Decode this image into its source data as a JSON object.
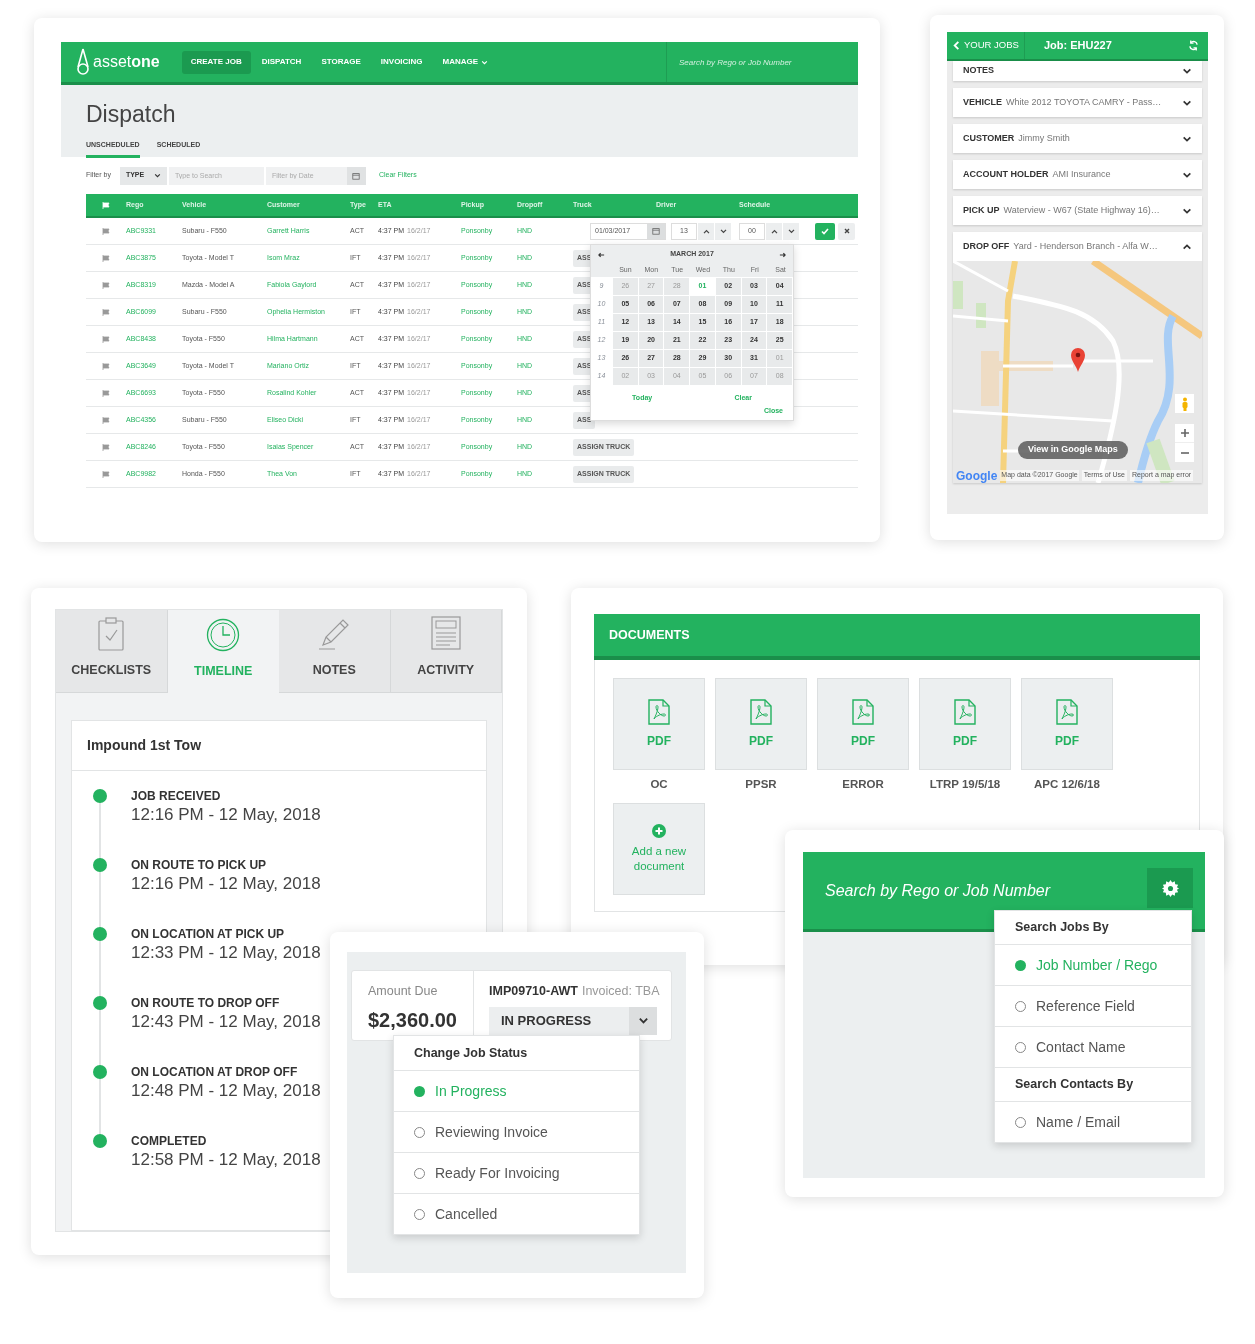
{
  "dispatch": {
    "nav": {
      "logo": "asset**one**",
      "items": [
        {
          "label": "CREATE JOB",
          "selected": true,
          "dropdown": false
        },
        {
          "label": "DISPATCH",
          "selected": false,
          "dropdown": false
        },
        {
          "label": "STORAGE",
          "selected": false,
          "dropdown": false
        },
        {
          "label": "INVOICING",
          "selected": false,
          "dropdown": false
        },
        {
          "label": "MANAGE",
          "selected": false,
          "dropdown": true
        }
      ],
      "search_placeholder": "Search by Rego or Job Number"
    },
    "title": "Dispatch",
    "tabs": [
      {
        "label": "UNSCHEDULED",
        "selected": true
      },
      {
        "label": "SCHEDULED",
        "selected": false
      }
    ],
    "filter": {
      "label": "Filter by",
      "type_value": "TYPE",
      "search_placeholder": "Type to Search",
      "date_placeholder": "Filter by Date",
      "clear": "Clear Filters"
    },
    "table": {
      "columns": [
        "Rego",
        "Vehicle",
        "Customer",
        "Type",
        "ETA",
        "Pickup",
        "Dropoff",
        "Truck",
        "Driver",
        "Schedule"
      ],
      "rows": [
        {
          "rego": "ABC9331",
          "vehicle": "Subaru - F550",
          "customer": "Garrett Harris",
          "type": "ACT",
          "eta_time": "4:37 PM",
          "eta_date": "16/2/17",
          "pickup": "Ponsonby",
          "dropoff": "HND",
          "editor": {
            "date": "01/03/2017",
            "hour": "13",
            "minute": "00"
          }
        },
        {
          "rego": "ABC3875",
          "vehicle": "Toyota - Model T",
          "customer": "Isom Mraz",
          "type": "IFT",
          "eta_time": "4:37 PM",
          "eta_date": "16/2/17",
          "pickup": "Ponsonby",
          "dropoff": "HND",
          "truck": "ASS"
        },
        {
          "rego": "ABC8319",
          "vehicle": "Mazda - Model A",
          "customer": "Fabiola Gaylord",
          "type": "ACT",
          "eta_time": "4:37 PM",
          "eta_date": "16/2/17",
          "pickup": "Ponsonby",
          "dropoff": "HND",
          "truck": "ASS"
        },
        {
          "rego": "ABC6099",
          "vehicle": "Subaru - F550",
          "customer": "Ophelia Hermiston",
          "type": "IFT",
          "eta_time": "4:37 PM",
          "eta_date": "16/2/17",
          "pickup": "Ponsonby",
          "dropoff": "HND",
          "truck": "ASS"
        },
        {
          "rego": "ABC8438",
          "vehicle": "Toyota - F550",
          "customer": "Hilma Hartmann",
          "type": "ACT",
          "eta_time": "4:37 PM",
          "eta_date": "16/2/17",
          "pickup": "Ponsonby",
          "dropoff": "HND",
          "truck": "ASS"
        },
        {
          "rego": "ABC3649",
          "vehicle": "Toyota - Model T",
          "customer": "Mariano Ortiz",
          "type": "IFT",
          "eta_time": "4:37 PM",
          "eta_date": "16/2/17",
          "pickup": "Ponsonby",
          "dropoff": "HND",
          "truck": "ASS"
        },
        {
          "rego": "ABC6693",
          "vehicle": "Toyota - F550",
          "customer": "Rosalind Kohler",
          "type": "ACT",
          "eta_time": "4:37 PM",
          "eta_date": "16/2/17",
          "pickup": "Ponsonby",
          "dropoff": "HND",
          "truck": "ASS"
        },
        {
          "rego": "ABC4356",
          "vehicle": "Subaru - F550",
          "customer": "Eliseo Dicki",
          "type": "IFT",
          "eta_time": "4:37 PM",
          "eta_date": "16/2/17",
          "pickup": "Ponsonby",
          "dropoff": "HND",
          "truck": "ASS"
        },
        {
          "rego": "ABC8246",
          "vehicle": "Toyota - F550",
          "customer": "Isaias Spencer",
          "type": "ACT",
          "eta_time": "4:37 PM",
          "eta_date": "16/2/17",
          "pickup": "Ponsonby",
          "dropoff": "HND",
          "truck": "ASSIGN TRUCK"
        },
        {
          "rego": "ABC9982",
          "vehicle": "Honda - F550",
          "customer": "Thea Von",
          "type": "IFT",
          "eta_time": "4:37 PM",
          "eta_date": "16/2/17",
          "pickup": "Ponsonby",
          "dropoff": "HND",
          "truck": "ASSIGN TRUCK"
        }
      ]
    },
    "calendar": {
      "month": "MARCH 2017",
      "weekdays": [
        "Sun",
        "Mon",
        "Tue",
        "Wed",
        "Thu",
        "Fri",
        "Sat"
      ],
      "weeks": [
        {
          "number": "9",
          "days": [
            {
              "d": "26",
              "kind": "other",
              "selected": false
            },
            {
              "d": "27",
              "kind": "other",
              "selected": false
            },
            {
              "d": "28",
              "kind": "other",
              "selected": false
            },
            {
              "d": "01",
              "kind": "current",
              "selected": true
            },
            {
              "d": "02",
              "kind": "current",
              "selected": false
            },
            {
              "d": "03",
              "kind": "current",
              "selected": false
            },
            {
              "d": "04",
              "kind": "current",
              "selected": false
            }
          ]
        },
        {
          "number": "10",
          "days": [
            {
              "d": "05",
              "kind": "current",
              "selected": false
            },
            {
              "d": "06",
              "kind": "current",
              "selected": false
            },
            {
              "d": "07",
              "kind": "current",
              "selected": false
            },
            {
              "d": "08",
              "kind": "current",
              "selected": false
            },
            {
              "d": "09",
              "kind": "current",
              "selected": false
            },
            {
              "d": "10",
              "kind": "current",
              "selected": false
            },
            {
              "d": "11",
              "kind": "current",
              "selected": false
            }
          ]
        },
        {
          "number": "11",
          "days": [
            {
              "d": "12",
              "kind": "current",
              "selected": false
            },
            {
              "d": "13",
              "kind": "current",
              "selected": false
            },
            {
              "d": "14",
              "kind": "current",
              "selected": false
            },
            {
              "d": "15",
              "kind": "current",
              "selected": false
            },
            {
              "d": "16",
              "kind": "current",
              "selected": false
            },
            {
              "d": "17",
              "kind": "current",
              "selected": false
            },
            {
              "d": "18",
              "kind": "current",
              "selected": false
            }
          ]
        },
        {
          "number": "12",
          "days": [
            {
              "d": "19",
              "kind": "current",
              "selected": false
            },
            {
              "d": "20",
              "kind": "current",
              "selected": false
            },
            {
              "d": "21",
              "kind": "current",
              "selected": false
            },
            {
              "d": "22",
              "kind": "current",
              "selected": false
            },
            {
              "d": "23",
              "kind": "current",
              "selected": false
            },
            {
              "d": "24",
              "kind": "current",
              "selected": false
            },
            {
              "d": "25",
              "kind": "current",
              "selected": false
            }
          ]
        },
        {
          "number": "13",
          "days": [
            {
              "d": "26",
              "kind": "current",
              "selected": false
            },
            {
              "d": "27",
              "kind": "current",
              "selected": false
            },
            {
              "d": "28",
              "kind": "current",
              "selected": false
            },
            {
              "d": "29",
              "kind": "current",
              "selected": false
            },
            {
              "d": "30",
              "kind": "current",
              "selected": false
            },
            {
              "d": "31",
              "kind": "current",
              "selected": false
            },
            {
              "d": "01",
              "kind": "other",
              "selected": false
            }
          ]
        },
        {
          "number": "14",
          "days": [
            {
              "d": "02",
              "kind": "other",
              "selected": false
            },
            {
              "d": "03",
              "kind": "other",
              "selected": false
            },
            {
              "d": "04",
              "kind": "other",
              "selected": false
            },
            {
              "d": "05",
              "kind": "other",
              "selected": false
            },
            {
              "d": "06",
              "kind": "other",
              "selected": false
            },
            {
              "d": "07",
              "kind": "other",
              "selected": false
            },
            {
              "d": "08",
              "kind": "other",
              "selected": false
            }
          ]
        }
      ],
      "today": "Today",
      "clear": "Clear",
      "close": "Close"
    }
  },
  "mobile": {
    "back": "YOUR JOBS",
    "title": "Job: EHU227",
    "items": [
      {
        "label": "NOTES",
        "value": "",
        "expanded": false
      },
      {
        "label": "VEHICLE",
        "value": "White 2012 TOYOTA CAMRY - Pass…",
        "expanded": false
      },
      {
        "label": "CUSTOMER",
        "value": "Jimmy Smith",
        "expanded": false
      },
      {
        "label": "ACCOUNT HOLDER",
        "value": "AMI Insurance",
        "expanded": false
      },
      {
        "label": "PICK UP",
        "value": "Waterview - W67 (State Highway 16)…",
        "expanded": false
      },
      {
        "label": "DROP OFF",
        "value": "Yard - Henderson Branch - Alfa W…",
        "expanded": true,
        "map": {
          "button": "View in Google Maps",
          "logo": "Google",
          "attribution": "Map data ©2017 Google",
          "terms": "Terms of Use",
          "report": "Report a map error"
        }
      }
    ]
  },
  "timeline": {
    "tabs": [
      {
        "label": "CHECKLISTS",
        "selected": false
      },
      {
        "label": "TIMELINE",
        "selected": true
      },
      {
        "label": "NOTES",
        "selected": false
      },
      {
        "label": "ACTIVITY",
        "selected": false
      }
    ],
    "title": "Impound 1st Tow",
    "events": [
      {
        "label": "JOB RECEIVED",
        "time": "12:16 PM - 12 May, 2018"
      },
      {
        "label": "ON ROUTE TO PICK UP",
        "time": "12:16 PM - 12 May, 2018"
      },
      {
        "label": "ON LOCATION AT PICK UP",
        "time": "12:33 PM - 12 May, 2018"
      },
      {
        "label": "ON ROUTE TO DROP OFF",
        "time": "12:43 PM - 12 May, 2018"
      },
      {
        "label": "ON LOCATION AT DROP OFF",
        "time": "12:48 PM - 12 May, 2018"
      },
      {
        "label": "COMPLETED",
        "time": "12:58 PM - 12 May, 2018"
      }
    ]
  },
  "documents": {
    "title": "DOCUMENTS",
    "files": [
      {
        "badge": "PDF",
        "name": "OC"
      },
      {
        "badge": "PDF",
        "name": "PPSR"
      },
      {
        "badge": "PDF",
        "name": "ERROR"
      },
      {
        "badge": "PDF",
        "name": "LTRP 19/5/18"
      },
      {
        "badge": "PDF",
        "name": "APC 12/6/18"
      }
    ],
    "add": "Add a new document"
  },
  "invoice": {
    "amount_label": "Amount Due",
    "amount": "$2,360.00",
    "job_id": "IMP09710-AWT",
    "invoiced": "Invoiced: TBA",
    "status": "IN PROGRESS",
    "menu": {
      "heading": "Change Job Status",
      "options": [
        {
          "label": "In Progress",
          "selected": true
        },
        {
          "label": "Reviewing Invoice",
          "selected": false
        },
        {
          "label": "Ready For Invoicing",
          "selected": false
        },
        {
          "label": "Cancelled",
          "selected": false
        }
      ]
    }
  },
  "search": {
    "placeholder": "Search by Rego or Job Number",
    "groups": [
      {
        "heading": "Search Jobs By",
        "options": [
          {
            "label": "Job Number / Rego",
            "selected": true
          },
          {
            "label": "Reference Field",
            "selected": false
          },
          {
            "label": "Contact Name",
            "selected": false
          }
        ]
      },
      {
        "heading": "Search Contacts By",
        "options": [
          {
            "label": "Name / Email",
            "selected": false
          }
        ]
      }
    ]
  }
}
